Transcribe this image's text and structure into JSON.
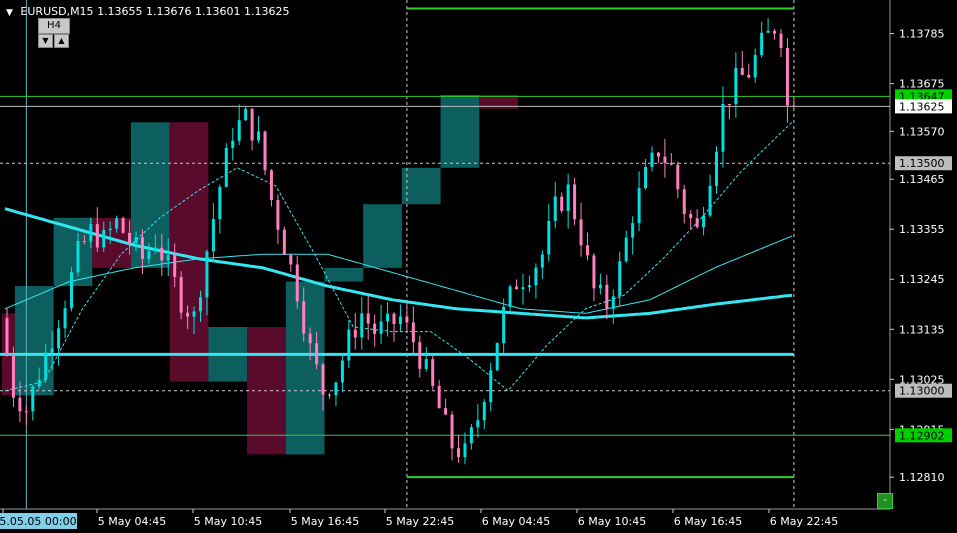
{
  "header": {
    "symbol": "EURUSD,M15",
    "ohlc": "1.13655 1.13676 1.13601 1.13625",
    "dropdown_icon": "triangle-down-icon"
  },
  "timeframe_widget": {
    "label": "H4",
    "down_icon": "triangle-down-icon",
    "up_icon": "triangle-up-icon"
  },
  "corner_button": {
    "label": "-"
  },
  "colors": {
    "background": "#000000",
    "bull_candle": "#ff7fbf",
    "bear_candle": "#00e0e0",
    "bull_box": "#0d5f5f",
    "bear_box": "#5a0a2a",
    "ma_thick": "#33e6f0",
    "level_line": "#32cd32",
    "grid_dash": "#cccccc"
  },
  "chart_data": {
    "type": "candlestick",
    "title": "EURUSD,M15",
    "ylim": [
      1.1274,
      1.1385
    ],
    "y_ticks": [
      "1.13785",
      "1.13675",
      "1.13570",
      "1.13465",
      "1.13355",
      "1.13245",
      "1.13135",
      "1.13025",
      "1.12915",
      "1.12810"
    ],
    "x_ticks": [
      "5.05.05 00:00",
      "5 May 04:45",
      "5 May 10:45",
      "5 May 16:45",
      "5 May 22:45",
      "6 May 04:45",
      "6 May 10:45",
      "6 May 16:45",
      "6 May 22:45"
    ],
    "price_labels": [
      {
        "value": "1.13647",
        "style": "green"
      },
      {
        "value": "1.13625",
        "style": "white"
      },
      {
        "value": "1.13500",
        "style": "gray"
      },
      {
        "value": "1.13000",
        "style": "gray"
      },
      {
        "value": "1.12902",
        "style": "green"
      }
    ],
    "horizontal_levels": {
      "green_thin": [
        1.1384,
        1.13647,
        1.12902,
        1.1281
      ],
      "cyan_thick": [
        1.1308
      ],
      "dashed": [
        1.135,
        1.13
      ],
      "current_price": 1.13625
    },
    "h4_boxes": [
      {
        "t0": 0,
        "t1": 1,
        "open": 1.1317,
        "close": 1.1299,
        "dir": "down"
      },
      {
        "t0": 2,
        "t1": 7,
        "open": 1.1299,
        "close": 1.1323,
        "dir": "up"
      },
      {
        "t0": 8,
        "t1": 13,
        "open": 1.1323,
        "close": 1.1338,
        "dir": "up"
      },
      {
        "t0": 14,
        "t1": 19,
        "open": 1.1338,
        "close": 1.1327,
        "dir": "down"
      },
      {
        "t0": 20,
        "t1": 25,
        "open": 1.1327,
        "close": 1.1359,
        "dir": "up"
      },
      {
        "t0": 26,
        "t1": 31,
        "open": 1.1359,
        "close": 1.1302,
        "dir": "down"
      },
      {
        "t0": 32,
        "t1": 37,
        "open": 1.1302,
        "close": 1.1314,
        "dir": "up"
      },
      {
        "t0": 38,
        "t1": 43,
        "open": 1.1314,
        "close": 1.1286,
        "dir": "down"
      },
      {
        "t0": 44,
        "t1": 49,
        "open": 1.1286,
        "close": 1.1324,
        "dir": "up"
      },
      {
        "t0": 50,
        "t1": 55,
        "open": 1.1324,
        "close": 1.1327,
        "dir": "up"
      },
      {
        "t0": 56,
        "t1": 61,
        "open": 1.1327,
        "close": 1.1341,
        "dir": "up"
      },
      {
        "t0": 62,
        "t1": 67,
        "open": 1.1341,
        "close": 1.1349,
        "dir": "up"
      },
      {
        "t0": 68,
        "t1": 73,
        "open": 1.1349,
        "close": 1.1365,
        "dir": "up"
      },
      {
        "t0": 74,
        "t1": 79,
        "open": 1.1365,
        "close": 1.1362,
        "dir": "down"
      }
    ],
    "candle_keyframes": [
      [
        0,
        1.1316
      ],
      [
        2,
        1.13
      ],
      [
        4,
        1.1296
      ],
      [
        6,
        1.1304
      ],
      [
        8,
        1.1312
      ],
      [
        10,
        1.132
      ],
      [
        12,
        1.133
      ],
      [
        14,
        1.1335
      ],
      [
        16,
        1.1333
      ],
      [
        18,
        1.1337
      ],
      [
        20,
        1.1333
      ],
      [
        22,
        1.1329
      ],
      [
        24,
        1.1333
      ],
      [
        26,
        1.1327
      ],
      [
        28,
        1.132
      ],
      [
        30,
        1.1316
      ],
      [
        32,
        1.1331
      ],
      [
        34,
        1.1345
      ],
      [
        36,
        1.1357
      ],
      [
        38,
        1.136
      ],
      [
        40,
        1.1355
      ],
      [
        42,
        1.1342
      ],
      [
        44,
        1.1332
      ],
      [
        46,
        1.1322
      ],
      [
        48,
        1.1309
      ],
      [
        50,
        1.13
      ],
      [
        52,
        1.1303
      ],
      [
        54,
        1.1311
      ],
      [
        56,
        1.1317
      ],
      [
        58,
        1.1313
      ],
      [
        60,
        1.1314
      ],
      [
        62,
        1.1316
      ],
      [
        64,
        1.1311
      ],
      [
        66,
        1.1304
      ],
      [
        68,
        1.1296
      ],
      [
        70,
        1.1288
      ],
      [
        72,
        1.1286
      ],
      [
        74,
        1.1294
      ],
      [
        76,
        1.1306
      ],
      [
        78,
        1.1317
      ],
      [
        80,
        1.1324
      ],
      [
        82,
        1.1326
      ],
      [
        84,
        1.133
      ],
      [
        86,
        1.134
      ],
      [
        88,
        1.1344
      ],
      [
        90,
        1.1334
      ],
      [
        92,
        1.1322
      ],
      [
        94,
        1.1319
      ],
      [
        96,
        1.1327
      ],
      [
        98,
        1.1339
      ],
      [
        100,
        1.1347
      ],
      [
        102,
        1.1353
      ],
      [
        104,
        1.1349
      ],
      [
        106,
        1.134
      ],
      [
        108,
        1.1335
      ],
      [
        110,
        1.1348
      ],
      [
        112,
        1.1362
      ],
      [
        114,
        1.1368
      ],
      [
        116,
        1.137
      ],
      [
        118,
        1.1376
      ],
      [
        120,
        1.138
      ],
      [
        121,
        1.1378
      ],
      [
        122,
        1.13625
      ]
    ],
    "ma_thick_keyframes": [
      [
        0,
        1.134
      ],
      [
        10,
        1.1336
      ],
      [
        20,
        1.1332
      ],
      [
        30,
        1.1329
      ],
      [
        40,
        1.1327
      ],
      [
        50,
        1.1323
      ],
      [
        60,
        1.132
      ],
      [
        70,
        1.1318
      ],
      [
        80,
        1.1317
      ],
      [
        90,
        1.1316
      ],
      [
        100,
        1.1317
      ],
      [
        110,
        1.1319
      ],
      [
        122,
        1.1321
      ]
    ],
    "ma_medium_keyframes": [
      [
        0,
        1.1318
      ],
      [
        10,
        1.1324
      ],
      [
        20,
        1.1327
      ],
      [
        30,
        1.1329
      ],
      [
        40,
        1.133
      ],
      [
        50,
        1.133
      ],
      [
        60,
        1.1326
      ],
      [
        70,
        1.1322
      ],
      [
        80,
        1.1318
      ],
      [
        90,
        1.1317
      ],
      [
        100,
        1.132
      ],
      [
        110,
        1.1327
      ],
      [
        122,
        1.1334
      ]
    ],
    "ma_dashed_keyframes": [
      [
        0,
        1.13
      ],
      [
        6,
        1.1302
      ],
      [
        12,
        1.1318
      ],
      [
        18,
        1.133
      ],
      [
        24,
        1.1338
      ],
      [
        30,
        1.1344
      ],
      [
        36,
        1.1349
      ],
      [
        42,
        1.1345
      ],
      [
        48,
        1.133
      ],
      [
        54,
        1.1314
      ],
      [
        60,
        1.1313
      ],
      [
        66,
        1.1313
      ],
      [
        72,
        1.1307
      ],
      [
        78,
        1.13
      ],
      [
        84,
        1.131
      ],
      [
        90,
        1.1318
      ],
      [
        96,
        1.1321
      ],
      [
        102,
        1.1329
      ],
      [
        108,
        1.1338
      ],
      [
        114,
        1.1348
      ],
      [
        122,
        1.1359
      ]
    ],
    "vertical_markers": [
      {
        "t": 3,
        "style": "solid-thin"
      },
      {
        "t": 62,
        "style": "dashed"
      },
      {
        "t": 122,
        "style": "dashed"
      }
    ]
  }
}
